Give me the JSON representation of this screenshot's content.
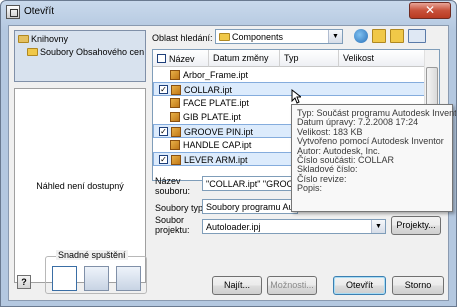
{
  "window": {
    "title": "Otevřít",
    "close_glyph": "✕"
  },
  "sidebar": {
    "items": [
      {
        "label": "Knihovny",
        "icon": "library-icon"
      },
      {
        "label": "Soubory Obsahového cen",
        "icon": "folder-icon"
      }
    ]
  },
  "preview": {
    "text": "Náhled není dostupný"
  },
  "location": {
    "label": "Oblast hledání:",
    "value": "Components"
  },
  "toolbar": {
    "icons": [
      "back-icon",
      "up-folder-icon",
      "new-folder-icon",
      "views-menu-icon"
    ]
  },
  "file_list": {
    "columns": [
      "Název",
      "Datum změny",
      "Typ",
      "Velikost"
    ],
    "rows": [
      {
        "name": "Arbor_Frame.ipt",
        "checked": false,
        "selected": false
      },
      {
        "name": "COLLAR.ipt",
        "checked": true,
        "selected": true
      },
      {
        "name": "FACE PLATE.ipt",
        "checked": false,
        "selected": false
      },
      {
        "name": "GIB PLATE.ipt",
        "checked": false,
        "selected": false
      },
      {
        "name": "GROOVE PIN.ipt",
        "checked": true,
        "selected": true
      },
      {
        "name": "HANDLE CAP.ipt",
        "checked": false,
        "selected": false
      },
      {
        "name": "LEVER ARM.ipt",
        "checked": true,
        "selected": true
      }
    ]
  },
  "tooltip": {
    "lines": [
      "Typ: Součást programu Autodesk Inventor",
      "Datum úpravy: 7.2.2008 17:24",
      "Velikost: 183 KB",
      "Vytvořeno pomocí Autodesk Inventor",
      "Autor: Autodesk, Inc.",
      "Číslo součásti: COLLAR",
      "Skladové číslo:",
      "Číslo revize:",
      "Popis:"
    ]
  },
  "form": {
    "filename_label_1": "Název",
    "filename_label_2": "souboru:",
    "filename_value": "\"COLLAR.ipt\" \"GROOVE",
    "filetype_label": "Soubory typu:",
    "filetype_value": "Soubory programu Autodesk Inventor (*.ipt;*.",
    "project_label_1": "Soubor",
    "project_label_2": "projektu:",
    "project_value": "Autoloader.ipj",
    "projects_button": "Projekty..."
  },
  "quick_launch": {
    "title": "Snadné spuštění",
    "icons": [
      "new-file-icon",
      "open-icon",
      "projects-icon"
    ]
  },
  "buttons": {
    "help": "?",
    "find": "Najít...",
    "options": "Možnosti...",
    "open": "Otevřít",
    "cancel": "Storno"
  },
  "colors": {
    "accent": "#3c7fb1",
    "selection": "#dcebfc",
    "close": "#c8513a"
  }
}
